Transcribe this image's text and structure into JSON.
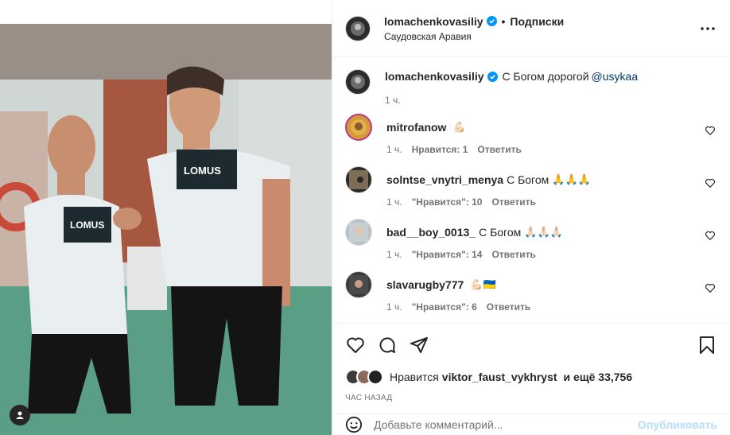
{
  "header": {
    "username": "lomachenkovasiliy",
    "follow_label": "Подписки",
    "location": "Саудовская Аравия",
    "dot": "•"
  },
  "caption": {
    "username": "lomachenkovasiliy",
    "text": "С Богом дорогой",
    "mention": "@usykaa",
    "time": "1 ч."
  },
  "comments": [
    {
      "username": "mitrofanow",
      "text": "",
      "emoji": "💪🏻",
      "time": "1 ч.",
      "likes": "Нравится: 1",
      "reply": "Ответить"
    },
    {
      "username": "solntse_vnytri_menya",
      "text": "С Богом",
      "emoji": "🙏🙏🙏",
      "time": "1 ч.",
      "likes": "\"Нравится\": 10",
      "reply": "Ответить"
    },
    {
      "username": "bad__boy_0013_",
      "text": "С Богом",
      "emoji": "🙏🏻🙏🏻🙏🏻",
      "time": "1 ч.",
      "likes": "\"Нравится\": 14",
      "reply": "Ответить"
    },
    {
      "username": "slavarugby777",
      "text": "",
      "emoji": "💪🏻🇺🇦",
      "time": "1 ч.",
      "likes": "\"Нравится\": 6",
      "reply": "Ответить"
    }
  ],
  "likes": {
    "prefix": "Нравится",
    "user": "viktor_faust_vykhryst",
    "suffix": "и ещё 33,756"
  },
  "time_ago": "ЧАС НАЗАД",
  "add_comment": {
    "placeholder": "Добавьте комментарий...",
    "publish": "Опубликовать"
  },
  "icons": [
    "heart-icon",
    "comment-icon",
    "share-icon",
    "bookmark-icon",
    "more-icon",
    "emoji-icon",
    "verified-icon",
    "user-tag-icon"
  ],
  "colors": {
    "verified": "#0095f6",
    "mention": "#00376b",
    "muted": "#737373"
  },
  "image": {
    "shirt_logo": "LOMUS"
  }
}
